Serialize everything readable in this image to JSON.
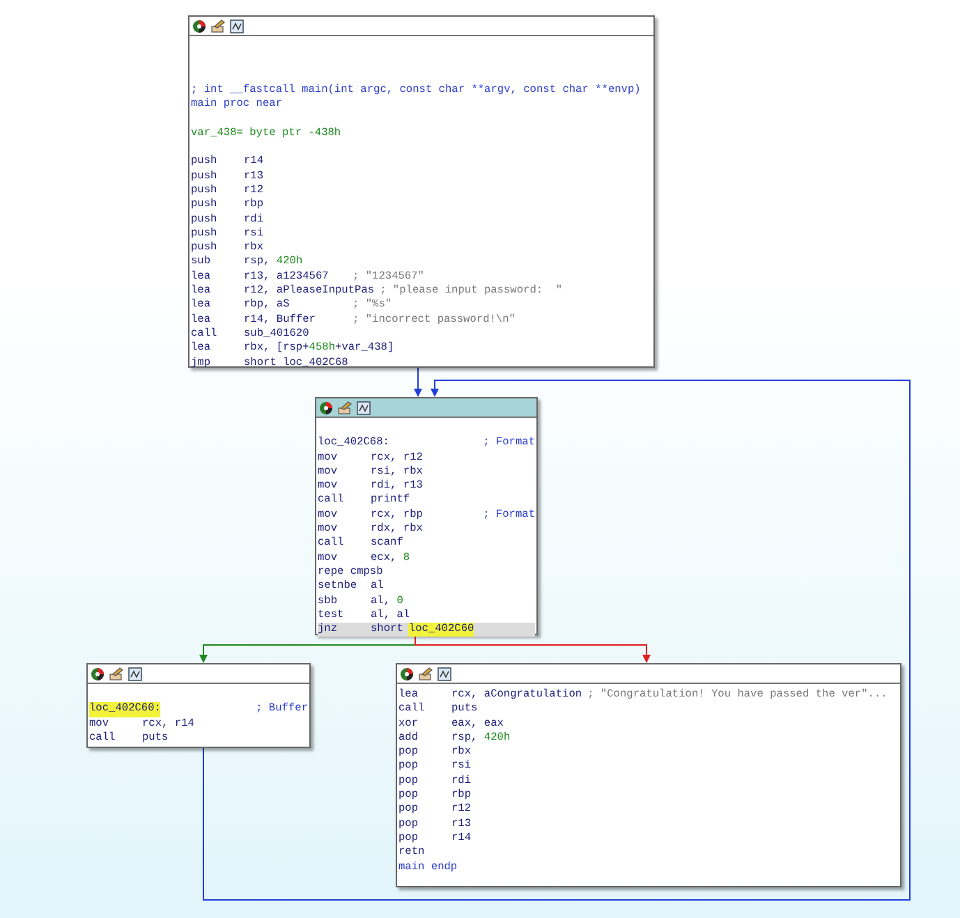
{
  "blocks": [
    {
      "selected": false,
      "lines": [
        {
          "kind": "blank"
        },
        {
          "kind": "blank"
        },
        {
          "kind": "blank"
        },
        {
          "kind": "comment",
          "text": "; int __fastcall main(int argc, const char **argv, const char **envp)"
        },
        {
          "kind": "directive",
          "text": "main proc near"
        },
        {
          "kind": "blank"
        },
        {
          "kind": "var",
          "text": "var_438= byte ptr -438h"
        },
        {
          "kind": "blank"
        },
        {
          "kind": "code",
          "op": "push",
          "args": "r14",
          "current": false
        },
        {
          "kind": "code",
          "op": "push",
          "args": "r13",
          "current": false
        },
        {
          "kind": "code",
          "op": "push",
          "args": "r12",
          "current": false
        },
        {
          "kind": "code",
          "op": "push",
          "args": "rbp",
          "current": false
        },
        {
          "kind": "code",
          "op": "push",
          "args": "rdi",
          "current": false
        },
        {
          "kind": "code",
          "op": "push",
          "args": "rsi",
          "current": false
        },
        {
          "kind": "code",
          "op": "push",
          "args": "rbx",
          "current": false
        },
        {
          "kind": "code",
          "op": "sub",
          "args": "rsp, 420h",
          "current": false
        },
        {
          "kind": "code",
          "op": "lea",
          "args": "r13, a1234567",
          "comment": "; \"1234567\"",
          "current": false
        },
        {
          "kind": "code",
          "op": "lea",
          "args": "r12, aPleaseInputPas",
          "comment": "; \"please input password:  \"",
          "current": false
        },
        {
          "kind": "code",
          "op": "lea",
          "args": "rbp, aS",
          "comment": "; \"%s\"",
          "current": false
        },
        {
          "kind": "code",
          "op": "lea",
          "args": "r14, Buffer",
          "comment": "; \"incorrect password!\\n\"",
          "current": false
        },
        {
          "kind": "code",
          "op": "call",
          "args": "sub_401620",
          "current": false
        },
        {
          "kind": "code",
          "op": "lea",
          "args": "rbx, [rsp+458h+var_438]",
          "current": false
        },
        {
          "kind": "code",
          "op": "jmp",
          "args": "short loc_402C68",
          "current": false
        }
      ]
    },
    {
      "selected": true,
      "lines": [
        {
          "kind": "blank"
        },
        {
          "kind": "label",
          "text": "loc_402C68:",
          "highlighted": false,
          "comment": "; Format"
        },
        {
          "kind": "code",
          "op": "mov",
          "args": "rcx, r12",
          "current": false
        },
        {
          "kind": "code",
          "op": "mov",
          "args": "rsi, rbx",
          "current": false
        },
        {
          "kind": "code",
          "op": "mov",
          "args": "rdi, r13",
          "current": false
        },
        {
          "kind": "code",
          "op": "call",
          "args": "printf",
          "current": false
        },
        {
          "kind": "code",
          "op": "mov",
          "args": "rcx, rbp",
          "comment": "; Format",
          "current": false
        },
        {
          "kind": "code",
          "op": "mov",
          "args": "rdx, rbx",
          "current": false
        },
        {
          "kind": "code",
          "op": "call",
          "args": "scanf",
          "current": false
        },
        {
          "kind": "code",
          "op": "mov",
          "args": "ecx, 8",
          "current": false
        },
        {
          "kind": "text",
          "text": "repe cmpsb"
        },
        {
          "kind": "code",
          "op": "setnbe",
          "args": "al",
          "current": false
        },
        {
          "kind": "code",
          "op": "sbb",
          "args": "al, 0",
          "current": false
        },
        {
          "kind": "code",
          "op": "test",
          "args": "al, al",
          "current": false
        },
        {
          "kind": "code",
          "op": "jnz",
          "args": "short",
          "target": "loc_402C60",
          "current": true
        }
      ]
    },
    {
      "selected": false,
      "lines": [
        {
          "kind": "blank"
        },
        {
          "kind": "label",
          "text": "loc_402C60:",
          "highlighted": true,
          "comment": "; Buffer"
        },
        {
          "kind": "code",
          "op": "mov",
          "args": "rcx, r14",
          "current": false
        },
        {
          "kind": "code",
          "op": "call",
          "args": "puts",
          "current": false
        }
      ]
    },
    {
      "selected": false,
      "lines": [
        {
          "kind": "code",
          "op": "lea",
          "args": "rcx, aCongratulation",
          "comment": "; \"Congratulation! You have passed the ver\"...",
          "current": false
        },
        {
          "kind": "code",
          "op": "call",
          "args": "puts",
          "current": false
        },
        {
          "kind": "code",
          "op": "xor",
          "args": "eax, eax",
          "current": false
        },
        {
          "kind": "code",
          "op": "add",
          "args": "rsp, 420h",
          "current": false
        },
        {
          "kind": "code",
          "op": "pop",
          "args": "rbx",
          "current": false
        },
        {
          "kind": "code",
          "op": "pop",
          "args": "rsi",
          "current": false
        },
        {
          "kind": "code",
          "op": "pop",
          "args": "rdi",
          "current": false
        },
        {
          "kind": "code",
          "op": "pop",
          "args": "rbp",
          "current": false
        },
        {
          "kind": "code",
          "op": "pop",
          "args": "r12",
          "current": false
        },
        {
          "kind": "code",
          "op": "pop",
          "args": "r13",
          "current": false
        },
        {
          "kind": "code",
          "op": "pop",
          "args": "r14",
          "current": false
        },
        {
          "kind": "text",
          "text": "retn"
        },
        {
          "kind": "directive",
          "text": "main endp"
        }
      ]
    }
  ],
  "edges": [
    {
      "kind": "flow"
    },
    {
      "kind": "true"
    },
    {
      "kind": "false"
    },
    {
      "kind": "loop"
    }
  ]
}
